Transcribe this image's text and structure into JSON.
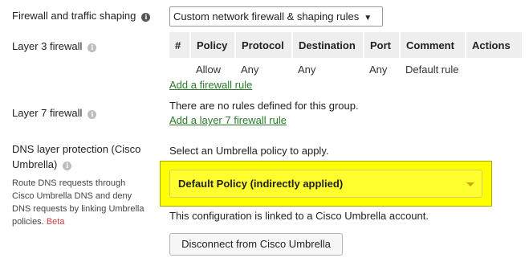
{
  "firewall": {
    "label": "Firewall and traffic shaping",
    "select_value": "Custom network firewall & shaping rules"
  },
  "layer3": {
    "label": "Layer 3 firewall",
    "columns": [
      "#",
      "Policy",
      "Protocol",
      "Destination",
      "Port",
      "Comment",
      "Actions"
    ],
    "rows": [
      {
        "index": "",
        "policy": "Allow",
        "protocol": "Any",
        "destination": "Any",
        "port": "Any",
        "comment": "Default rule",
        "actions": ""
      }
    ],
    "add_link": "Add a firewall rule"
  },
  "layer7": {
    "label": "Layer 7 firewall",
    "empty_text": "There are no rules defined for this group.",
    "add_link": "Add a layer 7 firewall rule"
  },
  "dns": {
    "label_line1": "DNS layer protection (Cisco",
    "label_line2": "Umbrella)",
    "desc_line1": "Route DNS requests through",
    "desc_line2": "Cisco Umbrella DNS and deny",
    "desc_line3": "DNS requests by linking Umbrella",
    "desc_line4": "policies.",
    "beta": "Beta",
    "prompt": "Select an Umbrella policy to apply.",
    "policy_value": "Default Policy (indirectly applied)",
    "linked_text": "This configuration is linked to a Cisco Umbrella account.",
    "disconnect_label": "Disconnect from Cisco Umbrella"
  },
  "colors": {
    "link": "#2a7a2a",
    "highlight": "#ffff00",
    "beta": "#d23a3a"
  }
}
